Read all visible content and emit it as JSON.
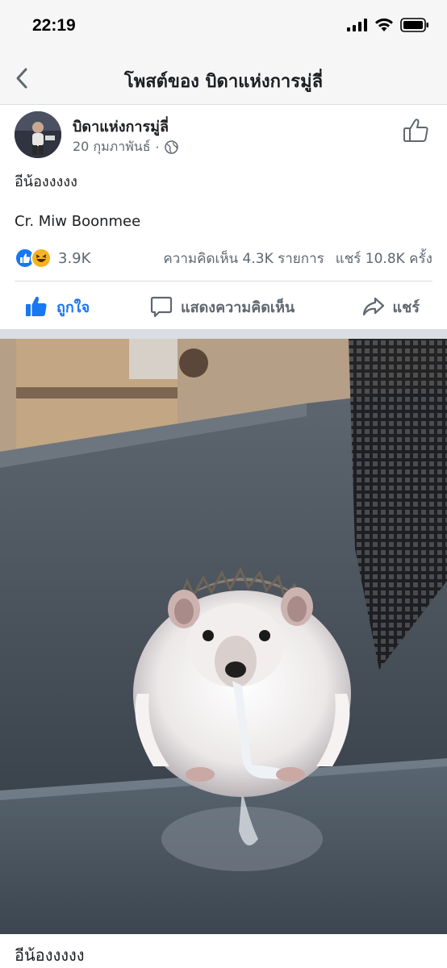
{
  "status_bar": {
    "time": "22:19"
  },
  "nav": {
    "title": "โพสต์ของ บิดาแห่งการมู่ลี่"
  },
  "post": {
    "author": "บิดาแห่งการมู่ลี่",
    "date": "20 กุมภาพันธ์",
    "separator": "·",
    "text_line1": "อีน้องงงงง",
    "text_line2": "Cr. Miw Boonmee",
    "reactions_count": "3.9K",
    "comments": "ความคิดเห็น 4.3K รายการ",
    "shares": "แชร์ 10.8K ครั้ง"
  },
  "actions": {
    "like": "ถูกใจ",
    "comment": "แสดงความคิดเห็น",
    "share": "แชร์"
  },
  "photo_caption": "อีน้องงงงง",
  "colors": {
    "accent": "#1877f2",
    "muted": "#606770",
    "haha": "#f7b125"
  }
}
